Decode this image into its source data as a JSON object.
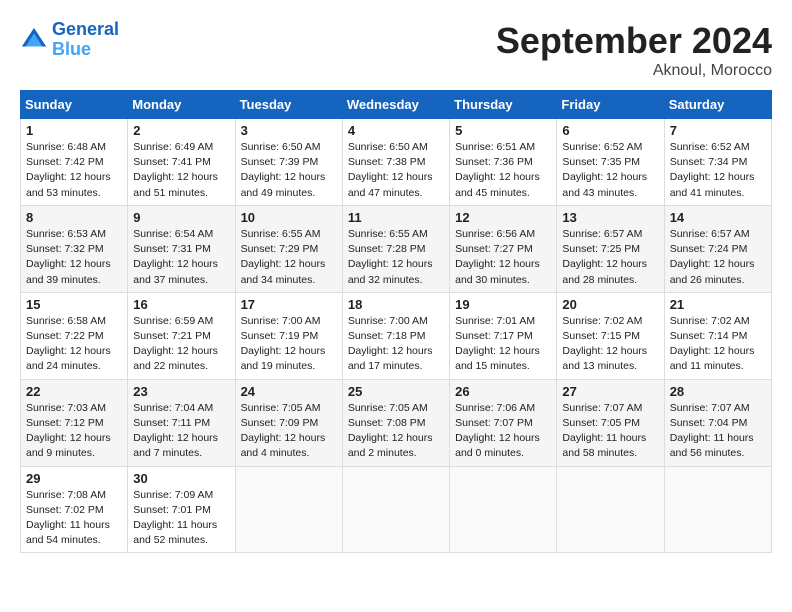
{
  "header": {
    "logo_line1": "General",
    "logo_line2": "Blue",
    "month": "September 2024",
    "location": "Aknoul, Morocco"
  },
  "days_of_week": [
    "Sunday",
    "Monday",
    "Tuesday",
    "Wednesday",
    "Thursday",
    "Friday",
    "Saturday"
  ],
  "weeks": [
    [
      {
        "day": "1",
        "sunrise": "6:48 AM",
        "sunset": "7:42 PM",
        "daylight": "12 hours and 53 minutes."
      },
      {
        "day": "2",
        "sunrise": "6:49 AM",
        "sunset": "7:41 PM",
        "daylight": "12 hours and 51 minutes."
      },
      {
        "day": "3",
        "sunrise": "6:50 AM",
        "sunset": "7:39 PM",
        "daylight": "12 hours and 49 minutes."
      },
      {
        "day": "4",
        "sunrise": "6:50 AM",
        "sunset": "7:38 PM",
        "daylight": "12 hours and 47 minutes."
      },
      {
        "day": "5",
        "sunrise": "6:51 AM",
        "sunset": "7:36 PM",
        "daylight": "12 hours and 45 minutes."
      },
      {
        "day": "6",
        "sunrise": "6:52 AM",
        "sunset": "7:35 PM",
        "daylight": "12 hours and 43 minutes."
      },
      {
        "day": "7",
        "sunrise": "6:52 AM",
        "sunset": "7:34 PM",
        "daylight": "12 hours and 41 minutes."
      }
    ],
    [
      {
        "day": "8",
        "sunrise": "6:53 AM",
        "sunset": "7:32 PM",
        "daylight": "12 hours and 39 minutes."
      },
      {
        "day": "9",
        "sunrise": "6:54 AM",
        "sunset": "7:31 PM",
        "daylight": "12 hours and 37 minutes."
      },
      {
        "day": "10",
        "sunrise": "6:55 AM",
        "sunset": "7:29 PM",
        "daylight": "12 hours and 34 minutes."
      },
      {
        "day": "11",
        "sunrise": "6:55 AM",
        "sunset": "7:28 PM",
        "daylight": "12 hours and 32 minutes."
      },
      {
        "day": "12",
        "sunrise": "6:56 AM",
        "sunset": "7:27 PM",
        "daylight": "12 hours and 30 minutes."
      },
      {
        "day": "13",
        "sunrise": "6:57 AM",
        "sunset": "7:25 PM",
        "daylight": "12 hours and 28 minutes."
      },
      {
        "day": "14",
        "sunrise": "6:57 AM",
        "sunset": "7:24 PM",
        "daylight": "12 hours and 26 minutes."
      }
    ],
    [
      {
        "day": "15",
        "sunrise": "6:58 AM",
        "sunset": "7:22 PM",
        "daylight": "12 hours and 24 minutes."
      },
      {
        "day": "16",
        "sunrise": "6:59 AM",
        "sunset": "7:21 PM",
        "daylight": "12 hours and 22 minutes."
      },
      {
        "day": "17",
        "sunrise": "7:00 AM",
        "sunset": "7:19 PM",
        "daylight": "12 hours and 19 minutes."
      },
      {
        "day": "18",
        "sunrise": "7:00 AM",
        "sunset": "7:18 PM",
        "daylight": "12 hours and 17 minutes."
      },
      {
        "day": "19",
        "sunrise": "7:01 AM",
        "sunset": "7:17 PM",
        "daylight": "12 hours and 15 minutes."
      },
      {
        "day": "20",
        "sunrise": "7:02 AM",
        "sunset": "7:15 PM",
        "daylight": "12 hours and 13 minutes."
      },
      {
        "day": "21",
        "sunrise": "7:02 AM",
        "sunset": "7:14 PM",
        "daylight": "12 hours and 11 minutes."
      }
    ],
    [
      {
        "day": "22",
        "sunrise": "7:03 AM",
        "sunset": "7:12 PM",
        "daylight": "12 hours and 9 minutes."
      },
      {
        "day": "23",
        "sunrise": "7:04 AM",
        "sunset": "7:11 PM",
        "daylight": "12 hours and 7 minutes."
      },
      {
        "day": "24",
        "sunrise": "7:05 AM",
        "sunset": "7:09 PM",
        "daylight": "12 hours and 4 minutes."
      },
      {
        "day": "25",
        "sunrise": "7:05 AM",
        "sunset": "7:08 PM",
        "daylight": "12 hours and 2 minutes."
      },
      {
        "day": "26",
        "sunrise": "7:06 AM",
        "sunset": "7:07 PM",
        "daylight": "12 hours and 0 minutes."
      },
      {
        "day": "27",
        "sunrise": "7:07 AM",
        "sunset": "7:05 PM",
        "daylight": "11 hours and 58 minutes."
      },
      {
        "day": "28",
        "sunrise": "7:07 AM",
        "sunset": "7:04 PM",
        "daylight": "11 hours and 56 minutes."
      }
    ],
    [
      {
        "day": "29",
        "sunrise": "7:08 AM",
        "sunset": "7:02 PM",
        "daylight": "11 hours and 54 minutes."
      },
      {
        "day": "30",
        "sunrise": "7:09 AM",
        "sunset": "7:01 PM",
        "daylight": "11 hours and 52 minutes."
      },
      null,
      null,
      null,
      null,
      null
    ]
  ]
}
